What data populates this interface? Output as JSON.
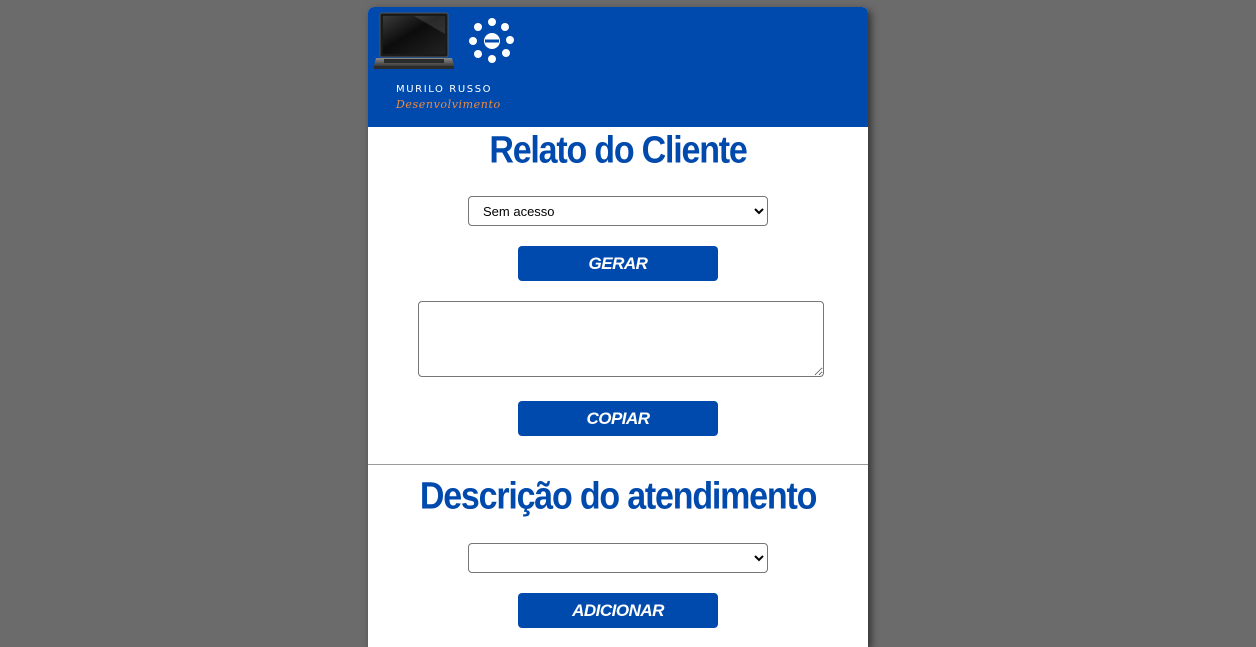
{
  "brand": {
    "name": "MURILO RUSSO",
    "tagline": "Desenvolvimento"
  },
  "section1": {
    "title": "Relato do Cliente",
    "select_value": "Sem acesso",
    "generate_label": "Gerar",
    "textarea_value": "",
    "copy_label": "Copiar"
  },
  "section2": {
    "title": "Descrição do atendimento",
    "select_value": "",
    "add_label": "Adicionar"
  },
  "colors": {
    "brand_blue": "#004aad",
    "background": "#6b6b6b",
    "accent_orange": "#f08a3c"
  },
  "icons": {
    "laptop": "laptop-icon",
    "network": "network-icon"
  }
}
